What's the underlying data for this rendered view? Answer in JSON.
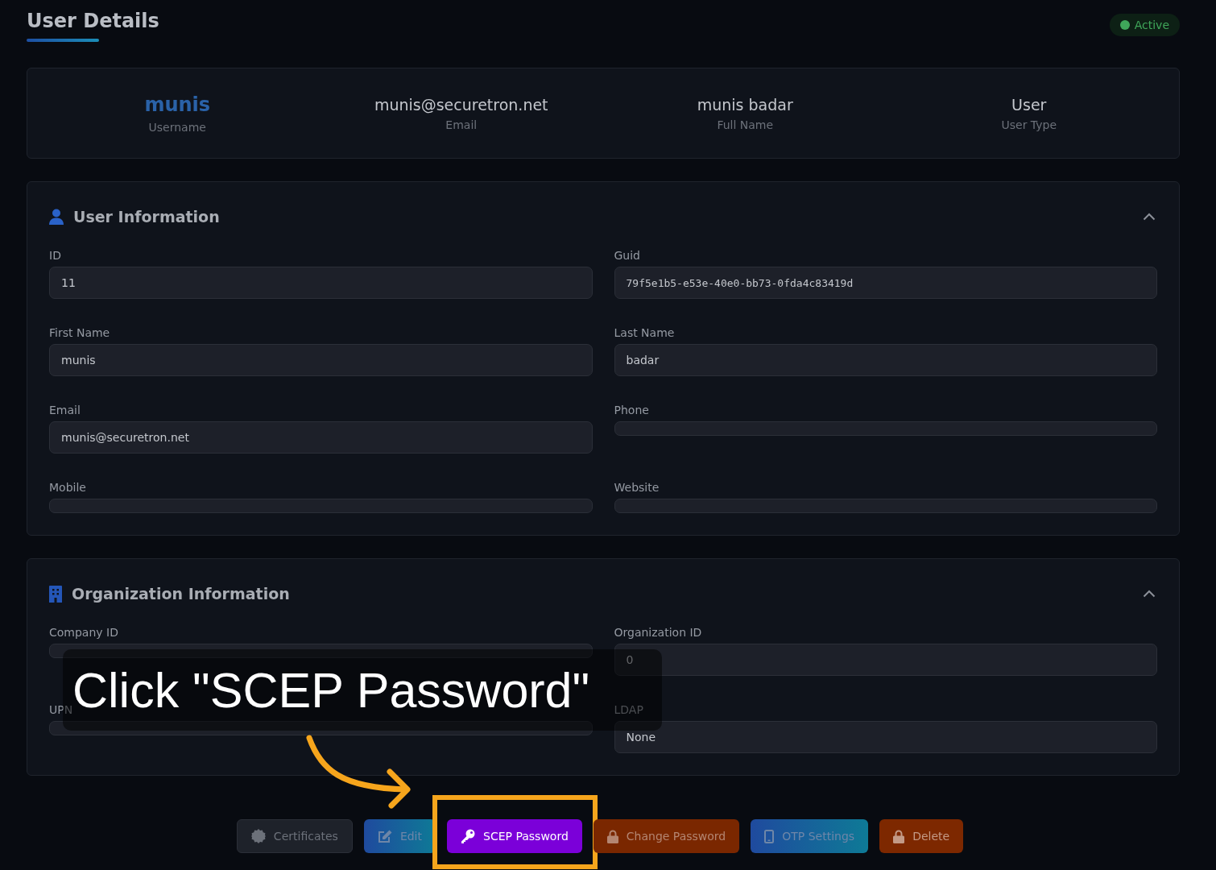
{
  "header": {
    "title": "User Details",
    "status": {
      "label": "Active",
      "color": "#3fa65a"
    }
  },
  "summary": [
    {
      "value": "munis",
      "label": "Username",
      "kind": "accent"
    },
    {
      "value": "munis@securetron.net",
      "label": "Email",
      "kind": "plain"
    },
    {
      "value": "munis badar",
      "label": "Full Name",
      "kind": "plain"
    },
    {
      "value": "User",
      "label": "User Type",
      "kind": "plain"
    }
  ],
  "sections": [
    {
      "title": "User Information",
      "kind": "user",
      "expanded": true,
      "fields": [
        {
          "label": "ID",
          "value": "11",
          "kind": "text"
        },
        {
          "label": "Guid",
          "value": "79f5e1b5-e53e-40e0-bb73-0fda4c83419d",
          "kind": "mono"
        },
        {
          "label": "First Name",
          "value": "munis",
          "kind": "text"
        },
        {
          "label": "Last Name",
          "value": "badar",
          "kind": "text"
        },
        {
          "label": "Email",
          "value": "munis@securetron.net",
          "kind": "text"
        },
        {
          "label": "Phone",
          "kind": "text"
        },
        {
          "label": "Mobile",
          "kind": "text"
        },
        {
          "label": "Website",
          "kind": "text"
        }
      ]
    },
    {
      "title": "Organization Information",
      "kind": "organization",
      "expanded": true,
      "fields": [
        {
          "label": "Company ID",
          "kind": "text"
        },
        {
          "label": "Organization ID",
          "value": "0",
          "kind": "text"
        },
        {
          "label": "UPN",
          "kind": "text"
        },
        {
          "label": "LDAP",
          "value": "None",
          "kind": "text"
        }
      ]
    }
  ],
  "actions": [
    {
      "label": "Certificates",
      "kind": "certificates",
      "highlighted": false
    },
    {
      "label": "Edit",
      "kind": "edit",
      "highlighted": false
    },
    {
      "label": "SCEP Password",
      "kind": "scep",
      "highlighted": true
    },
    {
      "label": "Change Password",
      "kind": "password",
      "highlighted": false
    },
    {
      "label": "OTP Settings",
      "kind": "otp",
      "highlighted": false
    },
    {
      "label": "Delete",
      "kind": "delete",
      "highlighted": false
    }
  ],
  "annotation": {
    "text": "Click \"SCEP Password\""
  }
}
